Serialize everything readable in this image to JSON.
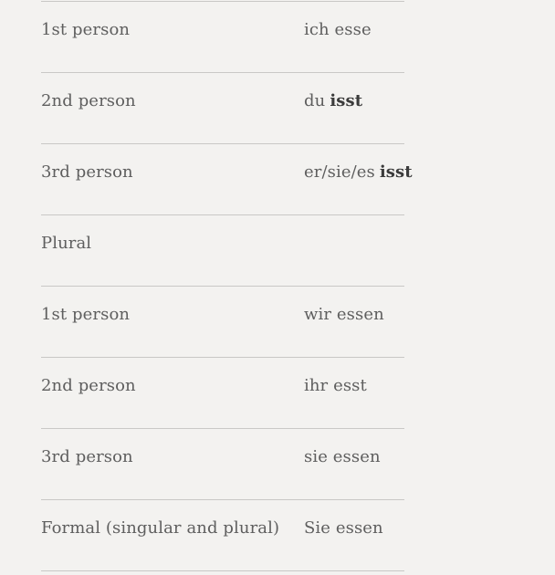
{
  "conjugation_table": {
    "rows": [
      {
        "person": "1st person",
        "form_prefix": "ich esse",
        "form_bold": ""
      },
      {
        "person": "2nd person",
        "form_prefix": "du",
        "form_bold": "isst"
      },
      {
        "person": "3rd person",
        "form_prefix": "er/sie/es",
        "form_bold": "isst"
      },
      {
        "person": "Plural",
        "form_prefix": "",
        "form_bold": ""
      },
      {
        "person": "1st person",
        "form_prefix": "wir essen",
        "form_bold": ""
      },
      {
        "person": "2nd person",
        "form_prefix": "ihr esst",
        "form_bold": ""
      },
      {
        "person": "3rd person",
        "form_prefix": "sie essen",
        "form_bold": ""
      },
      {
        "person": "Formal (singular and plural)",
        "form_prefix": "Sie essen",
        "form_bold": ""
      }
    ]
  }
}
